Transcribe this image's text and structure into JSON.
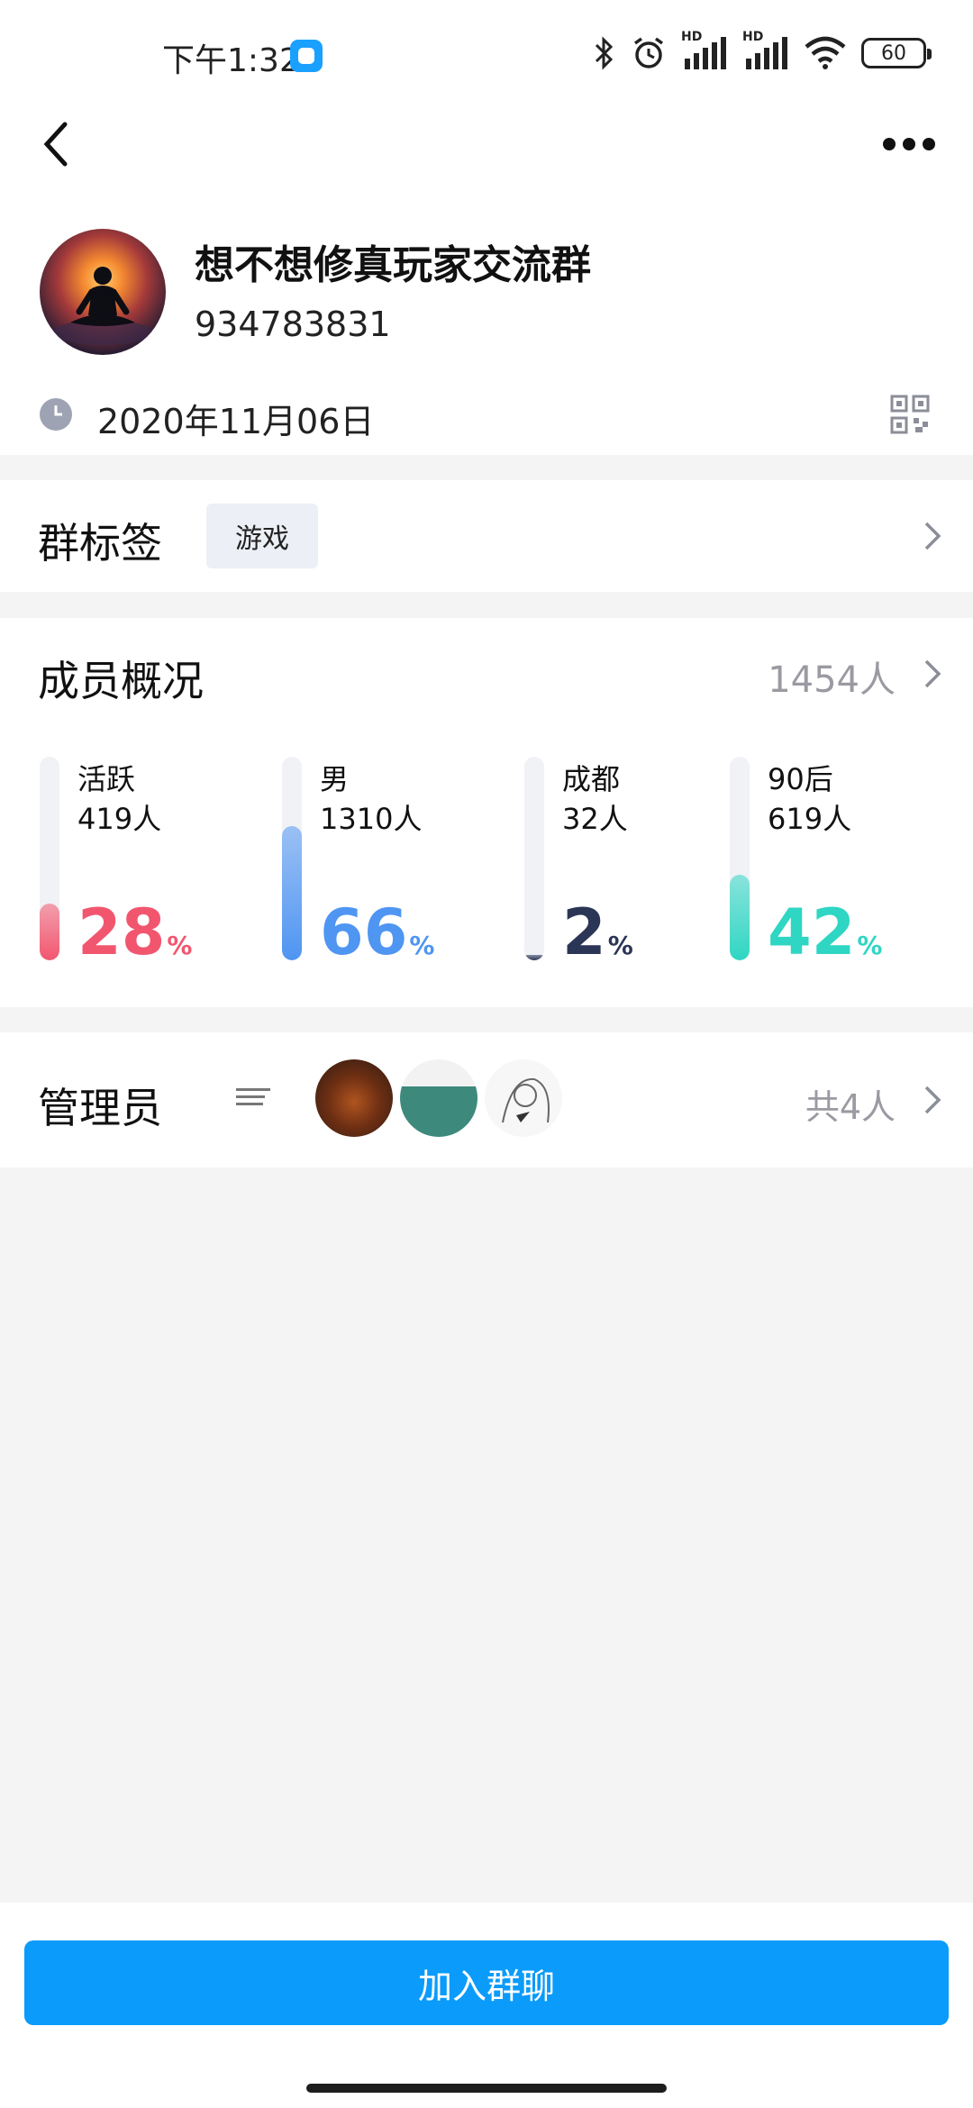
{
  "status_bar": {
    "time": "下午1:32",
    "hd1": "HD",
    "hd2": "HD",
    "battery": "60"
  },
  "group": {
    "name": "想不想修真玩家交流群",
    "id": "934783831",
    "created_date": "2020年11月06日"
  },
  "tags_section": {
    "title": "群标签",
    "tag": "游戏"
  },
  "members_section": {
    "title": "成员概况",
    "total": "1454人",
    "stats": [
      {
        "label": "活跃",
        "count": "419人",
        "percent": "28",
        "unit": "%",
        "fraction": 0.28,
        "color": "#f2566f"
      },
      {
        "label": "男",
        "count": "1310人",
        "percent": "66",
        "unit": "%",
        "fraction": 0.66,
        "color": "#4f95f2"
      },
      {
        "label": "成都",
        "count": "32人",
        "percent": "2",
        "unit": "%",
        "fraction": 0.02,
        "color": "#2b3556"
      },
      {
        "label": "90后",
        "count": "619人",
        "percent": "42",
        "unit": "%",
        "fraction": 0.42,
        "color": "#2fd6c3"
      }
    ]
  },
  "admins_section": {
    "title": "管理员",
    "total": "共4人"
  },
  "join_button": "加入群聊"
}
